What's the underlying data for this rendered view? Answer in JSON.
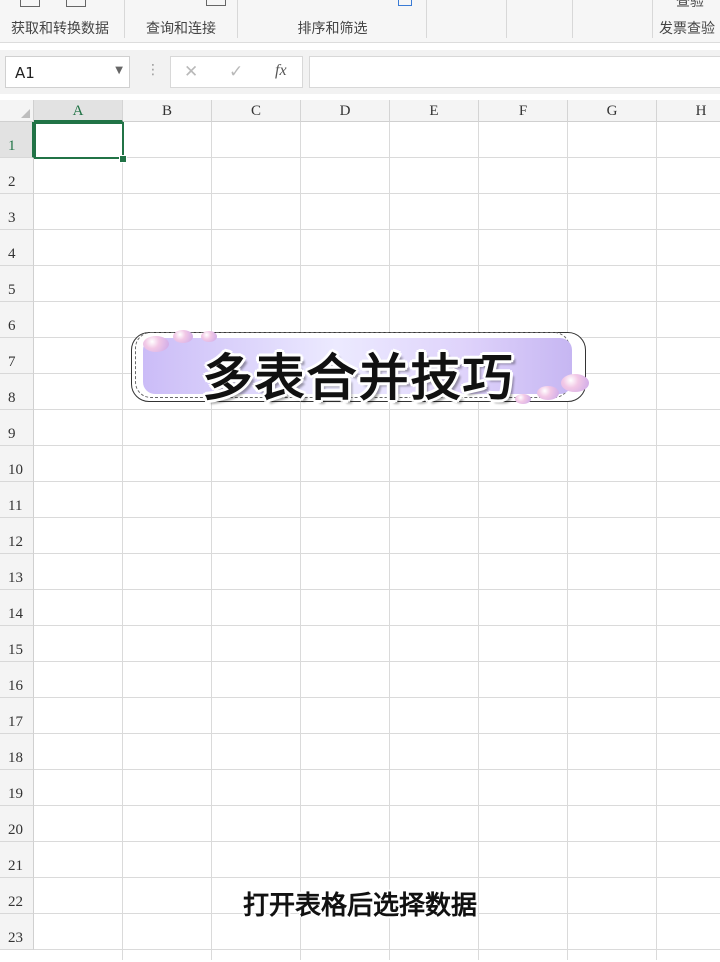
{
  "ribbon": {
    "groups": [
      {
        "label": "获取和转换数据"
      },
      {
        "label": "查询和连接"
      },
      {
        "label": "排序和筛选"
      },
      {
        "label": "发票查验"
      }
    ],
    "partial_top_text": "查验"
  },
  "formula_bar": {
    "name_box_value": "A1",
    "cancel_symbol": "✕",
    "enter_symbol": "✓",
    "fx_symbol": "fx",
    "formula_value": ""
  },
  "sheet": {
    "columns": [
      "A",
      "B",
      "C",
      "D",
      "E",
      "F",
      "G",
      "H"
    ],
    "rows": [
      "1",
      "2",
      "3",
      "4",
      "5",
      "6",
      "7",
      "8",
      "9",
      "10",
      "11",
      "12",
      "13",
      "14",
      "15",
      "16",
      "17",
      "18",
      "19",
      "20",
      "21",
      "22",
      "23"
    ],
    "active_cell": "A1",
    "selection_color": "#217346"
  },
  "overlay": {
    "title": "多表合并技巧",
    "subtitle": "打开表格后选择数据"
  }
}
